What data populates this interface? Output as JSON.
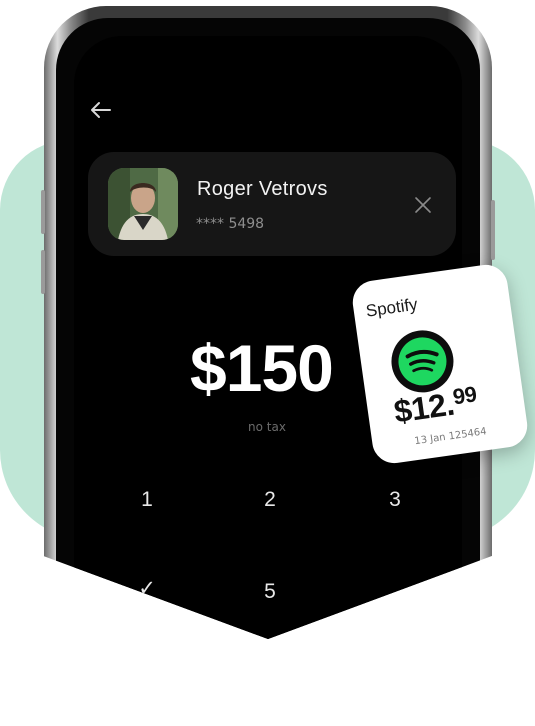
{
  "header": {
    "back_icon": "arrow-left-icon"
  },
  "recipient": {
    "name": "Roger Vetrovs",
    "account": "**** 5498",
    "close_icon": "close-icon"
  },
  "payment": {
    "amount": "$150",
    "note": "no tax"
  },
  "keypad": {
    "keys": [
      "1",
      "2",
      "3",
      "5"
    ]
  },
  "subscription": {
    "service": "Spotify",
    "price_main": "$12.",
    "price_cents": "99",
    "date": "13  Jan 125464",
    "logo_icon": "spotify-logo-icon",
    "brand_color": "#1ed760"
  },
  "colors": {
    "background_accent": "#bfe6d6",
    "screen": "#000000",
    "card": "#161616"
  }
}
